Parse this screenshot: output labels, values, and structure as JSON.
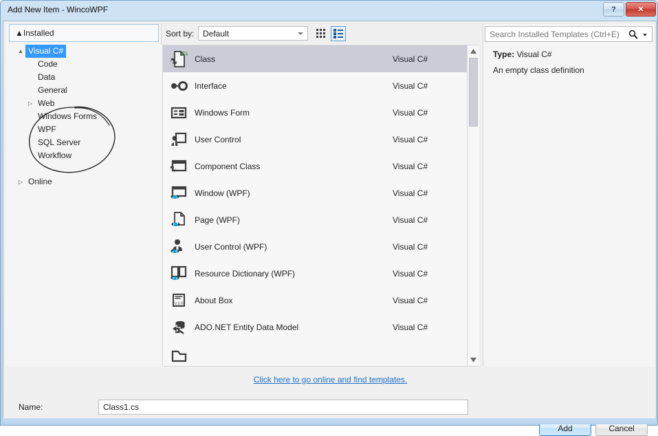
{
  "window": {
    "title": "Add New Item - WincoWPF",
    "help_button": "?",
    "close_button": "✕"
  },
  "left_pane": {
    "header": {
      "label": "Installed",
      "expander": "▲"
    },
    "tree": [
      {
        "label": "Visual C#",
        "indent": 0,
        "expander": "▲",
        "selected": true
      },
      {
        "label": "Code",
        "indent": 1,
        "expander": "",
        "selected": false
      },
      {
        "label": "Data",
        "indent": 1,
        "expander": "",
        "selected": false
      },
      {
        "label": "General",
        "indent": 1,
        "expander": "",
        "selected": false
      },
      {
        "label": "Web",
        "indent": 1,
        "expander": "▷",
        "selected": false
      },
      {
        "label": "Windows Forms",
        "indent": 1,
        "expander": "",
        "selected": false
      },
      {
        "label": "WPF",
        "indent": 1,
        "expander": "",
        "selected": false
      },
      {
        "label": "SQL Server",
        "indent": 1,
        "expander": "",
        "selected": false
      },
      {
        "label": "Workflow",
        "indent": 1,
        "expander": "",
        "selected": false
      },
      {
        "label": "",
        "indent": 0,
        "expander": "",
        "selected": false
      },
      {
        "label": "Online",
        "indent": 0,
        "expander": "▷",
        "selected": false
      }
    ],
    "annotation": "hand-drawn-ink-circle"
  },
  "toolbar": {
    "sort_by_label": "Sort by:",
    "sort_by_value": "Default",
    "view_tiles_icon": "grid-view-icon",
    "view_list_icon": "list-view-icon",
    "view_list_selected": true
  },
  "search": {
    "placeholder": "Search Installed Templates (Ctrl+E)",
    "value": "",
    "icon": "magnifier-icon"
  },
  "templates": {
    "lang_column_header": "Visual C#",
    "items": [
      {
        "name": "Class",
        "lang": "Visual C#",
        "icon": "class-file-icon",
        "selected": true
      },
      {
        "name": "Interface",
        "lang": "Visual C#",
        "icon": "interface-icon",
        "selected": false
      },
      {
        "name": "Windows Form",
        "lang": "Visual C#",
        "icon": "windows-form-icon",
        "selected": false
      },
      {
        "name": "User Control",
        "lang": "Visual C#",
        "icon": "user-control-icon",
        "selected": false
      },
      {
        "name": "Component Class",
        "lang": "Visual C#",
        "icon": "component-class-icon",
        "selected": false
      },
      {
        "name": "Window (WPF)",
        "lang": "Visual C#",
        "icon": "wpf-window-icon",
        "selected": false
      },
      {
        "name": "Page (WPF)",
        "lang": "Visual C#",
        "icon": "wpf-page-icon",
        "selected": false
      },
      {
        "name": "User Control (WPF)",
        "lang": "Visual C#",
        "icon": "wpf-user-control-icon",
        "selected": false
      },
      {
        "name": "Resource Dictionary (WPF)",
        "lang": "Visual C#",
        "icon": "resource-dictionary-icon",
        "selected": false
      },
      {
        "name": "About Box",
        "lang": "Visual C#",
        "icon": "about-box-icon",
        "selected": false
      },
      {
        "name": "ADO.NET Entity Data Model",
        "lang": "Visual C#",
        "icon": "ado-net-entity-icon",
        "selected": false
      }
    ]
  },
  "info_pane": {
    "type_label": "Type:",
    "type_value": "Visual C#",
    "description": "An empty class definition"
  },
  "footer": {
    "online_link": "Click here to go online and find templates.",
    "name_label": "Name:",
    "name_value": "Class1.cs",
    "add_button": "Add",
    "cancel_button": "Cancel"
  },
  "colors": {
    "selection_blue": "#3399ff",
    "list_selection": "#ccccd9",
    "link_blue": "#1a6fc4",
    "accent_border": "#9ec7e8",
    "close_red": "#c23a2c",
    "csharp_green": "#3f9c35",
    "wpf_cyan": "#00aeef"
  }
}
